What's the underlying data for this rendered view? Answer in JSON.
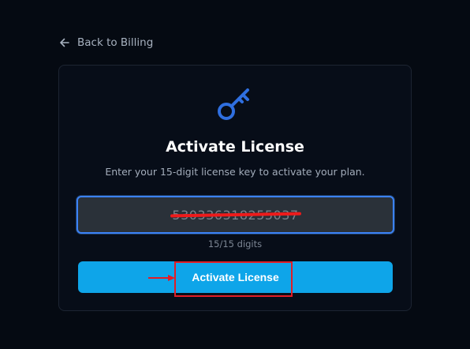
{
  "nav": {
    "back_label": "Back to Billing"
  },
  "card": {
    "title": "Activate License",
    "subtitle": "Enter your 15-digit license key to activate your plan.",
    "license_input_value": "530336318255037",
    "digit_counter": "15/15 digits",
    "activate_label": "Activate License"
  },
  "colors": {
    "background": "#050a12",
    "card": "#070d18",
    "accent_blue": "#0ea5e9",
    "focus_ring": "#3b82f6",
    "icon_blue": "#2f6fe0",
    "annotation_red": "#e11d26"
  },
  "icons": {
    "back": "arrow-left-icon",
    "key": "key-icon"
  }
}
